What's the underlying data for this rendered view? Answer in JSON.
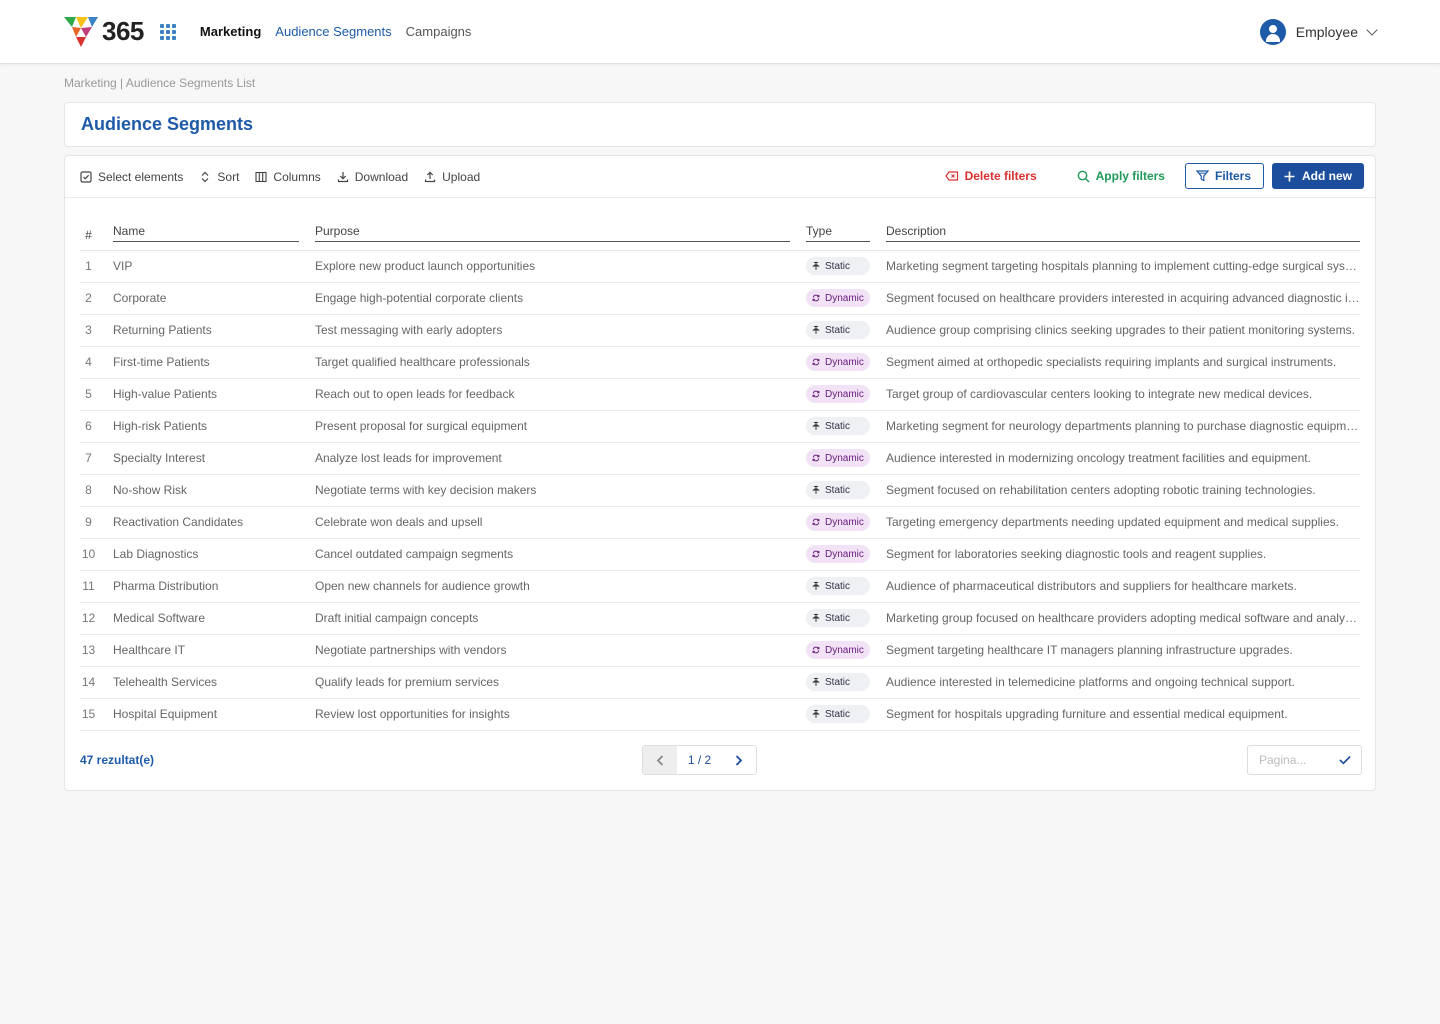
{
  "header": {
    "logo_text": "365",
    "nav": [
      {
        "label": "Marketing",
        "style": "bold"
      },
      {
        "label": "Audience Segments",
        "style": "active"
      },
      {
        "label": "Campaigns",
        "style": "normal"
      }
    ],
    "user": "Employee"
  },
  "breadcrumb": "Marketing | Audience Segments List",
  "page_title": "Audience Segments",
  "toolbar": {
    "select": "Select elements",
    "sort": "Sort",
    "columns": "Columns",
    "download": "Download",
    "upload": "Upload",
    "delete_filters": "Delete filters",
    "apply_filters": "Apply filters",
    "filters": "Filters",
    "add_new": "Add new"
  },
  "table": {
    "headers": {
      "num": "#",
      "name": "Name",
      "purpose": "Purpose",
      "type": "Type",
      "description": "Description"
    },
    "rows": [
      {
        "n": "1",
        "name": "VIP",
        "purpose": "Explore new product launch opportunities",
        "type": "Static",
        "description": "Marketing segment targeting hospitals planning to implement cutting-edge surgical systems."
      },
      {
        "n": "2",
        "name": "Corporate",
        "purpose": "Engage high-potential corporate clients",
        "type": "Dynamic",
        "description": "Segment focused on healthcare providers interested in acquiring advanced diagnostic imaging."
      },
      {
        "n": "3",
        "name": "Returning Patients",
        "purpose": "Test messaging with early adopters",
        "type": "Static",
        "description": "Audience group comprising clinics seeking upgrades to their patient monitoring systems."
      },
      {
        "n": "4",
        "name": "First-time Patients",
        "purpose": "Target qualified healthcare professionals",
        "type": "Dynamic",
        "description": "Segment aimed at orthopedic specialists requiring implants and surgical instruments."
      },
      {
        "n": "5",
        "name": "High-value Patients",
        "purpose": "Reach out to open leads for feedback",
        "type": "Dynamic",
        "description": "Target group of cardiovascular centers looking to integrate new medical devices."
      },
      {
        "n": "6",
        "name": "High-risk Patients",
        "purpose": "Present proposal for surgical equipment",
        "type": "Static",
        "description": "Marketing segment for neurology departments planning to purchase diagnostic equipment."
      },
      {
        "n": "7",
        "name": "Specialty Interest",
        "purpose": "Analyze lost leads for improvement",
        "type": "Dynamic",
        "description": "Audience interested in modernizing oncology treatment facilities and equipment."
      },
      {
        "n": "8",
        "name": "No-show Risk",
        "purpose": "Negotiate terms with key decision makers",
        "type": "Static",
        "description": "Segment focused on rehabilitation centers adopting robotic training technologies."
      },
      {
        "n": "9",
        "name": "Reactivation Candidates",
        "purpose": "Celebrate won deals and upsell",
        "type": "Dynamic",
        "description": "Targeting emergency departments needing updated equipment and medical supplies."
      },
      {
        "n": "10",
        "name": "Lab Diagnostics",
        "purpose": "Cancel outdated campaign segments",
        "type": "Dynamic",
        "description": "Segment for laboratories seeking diagnostic tools and reagent supplies."
      },
      {
        "n": "11",
        "name": "Pharma Distribution",
        "purpose": "Open new channels for audience growth",
        "type": "Static",
        "description": "Audience of pharmaceutical distributors and suppliers for healthcare markets."
      },
      {
        "n": "12",
        "name": "Medical Software",
        "purpose": "Draft initial campaign concepts",
        "type": "Static",
        "description": "Marketing group focused on healthcare providers adopting medical software and analytics."
      },
      {
        "n": "13",
        "name": "Healthcare IT",
        "purpose": "Negotiate partnerships with vendors",
        "type": "Dynamic",
        "description": "Segment targeting healthcare IT managers planning infrastructure upgrades."
      },
      {
        "n": "14",
        "name": "Telehealth Services",
        "purpose": "Qualify leads for premium services",
        "type": "Static",
        "description": "Audience interested in telemedicine platforms and ongoing technical support."
      },
      {
        "n": "15",
        "name": "Hospital Equipment",
        "purpose": "Review lost opportunities for insights",
        "type": "Static",
        "description": "Segment for hospitals upgrading furniture and essential medical equipment."
      }
    ]
  },
  "footer": {
    "results": "47 rezultat(e)",
    "page": "1 / 2",
    "goto_placeholder": "Pagina..."
  },
  "colors": {
    "primary": "#1d5aa8",
    "danger": "#d93030",
    "success": "#1f9a5a",
    "dynamic_bg": "#f1e3f5",
    "static_bg": "#eef0f4"
  }
}
